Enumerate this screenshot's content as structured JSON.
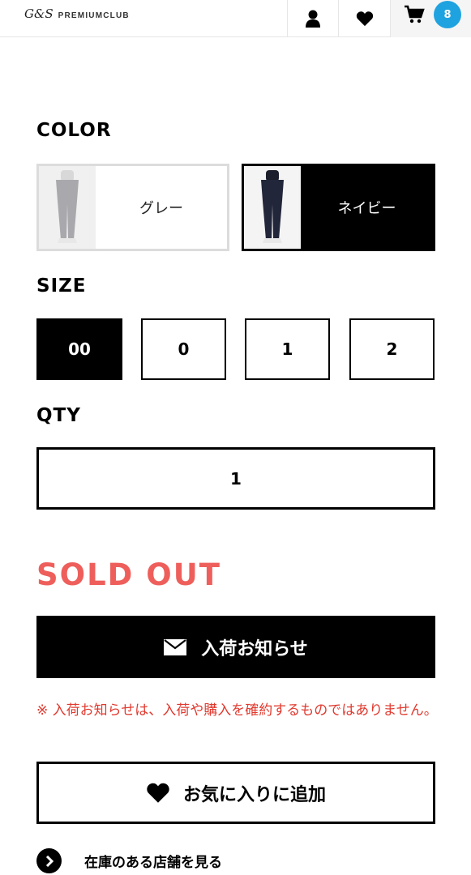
{
  "header": {
    "logo_mark": "G&S",
    "logo_text": "PREMIUMCLUB",
    "cart_count": "8",
    "icons": {
      "user": "user-icon",
      "favorites": "heart-icon",
      "cart": "cart-icon"
    }
  },
  "color": {
    "label": "COLOR",
    "options": [
      {
        "label": "グレー",
        "selected": false
      },
      {
        "label": "ネイビー",
        "selected": true
      }
    ]
  },
  "size": {
    "label": "SIZE",
    "options": [
      {
        "label": "00",
        "selected": true
      },
      {
        "label": "0",
        "selected": false
      },
      {
        "label": "1",
        "selected": false
      },
      {
        "label": "2",
        "selected": false
      }
    ]
  },
  "qty": {
    "label": "QTY",
    "value": "1"
  },
  "status": {
    "sold_out": "SOLD OUT",
    "sold_out_color": "#ee5f5b"
  },
  "actions": {
    "notify_label": "入荷お知らせ",
    "notice": "※ 入荷お知らせは、入荷や購入を確約するものではありません。",
    "favorite_label": "お気に入りに追加",
    "store_link_label": "在庫のある店舗を見る"
  },
  "colors": {
    "accent": "#1fa3e0",
    "alert": "#e03a2f"
  }
}
